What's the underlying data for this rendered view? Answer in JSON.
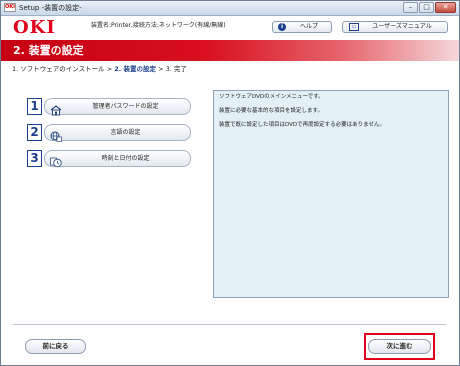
{
  "window": {
    "title": "Setup -装置の設定-",
    "app_icon_text": "OKI",
    "controls": {
      "minimize": "–",
      "maximize": "□",
      "close": "✕"
    }
  },
  "header": {
    "logo": "OKI",
    "device_info": "装置名:Printer,接続方法:ネットワーク(有線/無線)",
    "help_button": {
      "label": "ヘルプ",
      "icon": "help-icon",
      "icon_glyph": "i"
    },
    "manual_button": {
      "label": "ユーザーズマニュアル",
      "icon": "manual-book-icon",
      "icon_glyph": "▭"
    }
  },
  "banner": {
    "title": "2. 装置の設定",
    "color": "#d8101e"
  },
  "breadcrumb": {
    "step1": "1. ソフトウェアのインストール",
    "sep1": " > ",
    "step2": "2. 装置の設定",
    "sep2": " > ",
    "step3": "3. 完了"
  },
  "menu": {
    "items": [
      {
        "number": "1",
        "label": "管理者パスワードの設定",
        "icon": "house-lock-icon"
      },
      {
        "number": "2",
        "label": "言語の設定",
        "icon": "globe-language-icon"
      },
      {
        "number": "3",
        "label": "時刻と日付の設定",
        "icon": "clock-calendar-icon"
      }
    ]
  },
  "info": {
    "line1": "ソフトウェアDVDのメインメニューです。",
    "line2": "装置に必要な基本的な項目を設定します。",
    "line3": "装置で既に設定した項目はDVDで再度設定する必要はありません。"
  },
  "footer": {
    "back_button": "前に戻る",
    "next_button": "次に進む"
  },
  "colors": {
    "brand_red": "#e0001a",
    "accent_blue": "#1d3f8f",
    "info_bg": "#e3f1f7"
  }
}
